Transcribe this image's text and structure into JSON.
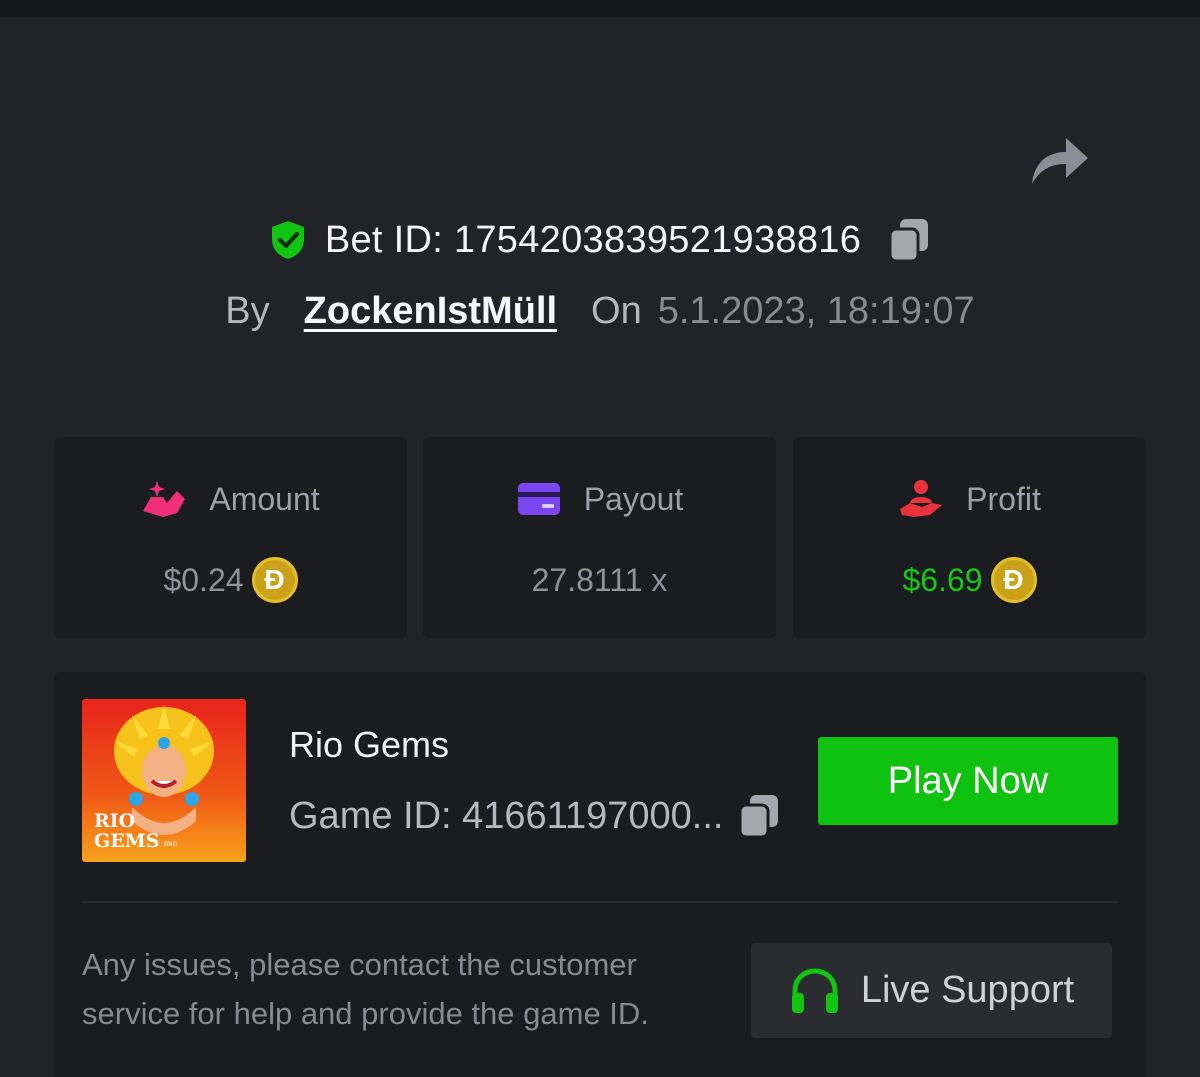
{
  "bet": {
    "id_label": "Bet ID: 1754203839521938816",
    "by_label": "By",
    "username": "ZockenIstMüll",
    "on_label": "On",
    "datetime": "5.1.2023, 18:19:07"
  },
  "stats": {
    "amount": {
      "label": "Amount",
      "value": "$0.24",
      "coin": "Đ",
      "icon": "hand-coins-icon"
    },
    "payout": {
      "label": "Payout",
      "value": "27.8111 x",
      "icon": "card-icon"
    },
    "profit": {
      "label": "Profit",
      "value": "$6.69",
      "coin": "Đ",
      "icon": "hand-user-icon"
    }
  },
  "game": {
    "title": "Rio Gems",
    "id_label": "Game ID: 41661197000...",
    "thumb_line1": "RIO",
    "thumb_line2": "GEMS",
    "thumb_brand": "BNG",
    "play_label": "Play Now"
  },
  "support": {
    "help_text": "Any issues, please contact the customer service for help and provide the game ID.",
    "button_label": "Live Support"
  },
  "colors": {
    "accent_green": "#0fc20f",
    "profit_green": "#16c715",
    "coin_gold": "#c9a21a",
    "amount_pink": "#ef2f7a",
    "payout_purple": "#7b46f0",
    "profit_red": "#e8333a"
  }
}
